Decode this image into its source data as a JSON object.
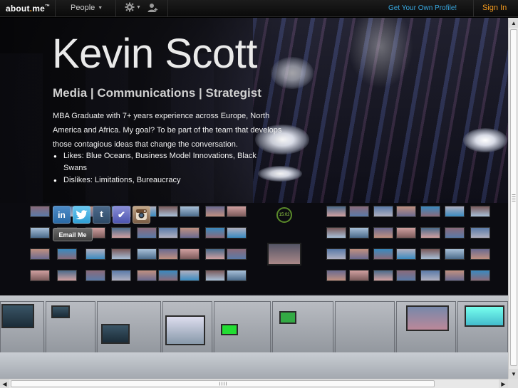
{
  "topbar": {
    "logo_main": "about",
    "logo_dot": ".",
    "logo_suffix": "me",
    "logo_tm": "™",
    "people_label": "People",
    "get_profile_label": "Get Your Own Profile!",
    "sign_in_label": "Sign In"
  },
  "profile": {
    "name": "Kevin Scott",
    "headline": "Media | Communications | Strategist",
    "bio": "MBA Graduate with 7+ years experience across Europe, North America and Africa. My goal? To be part of the team that develops those contagious ideas that change the conversation.",
    "likes": [
      "Likes: Blue Oceans, Business Model Innovations, Black Swans",
      "Dislikes: Limitations, Bureaucracy"
    ],
    "email_label": "Email Me"
  },
  "social": {
    "linkedin_glyph": "in",
    "twitter_glyph": "🐦",
    "tumblr_glyph": "t",
    "foursquare_glyph": "✔",
    "instagram_glyph": ""
  },
  "scene": {
    "clock_text": "15:02"
  },
  "colors": {
    "accent_orange": "#f39a1e",
    "link_blue": "#39a8e0",
    "topbar_bg": "#111111"
  },
  "icons": [
    "caret-down-icon",
    "gear-icon",
    "add-user-icon",
    "linkedin-icon",
    "twitter-icon",
    "tumblr-icon",
    "foursquare-icon",
    "instagram-icon"
  ]
}
